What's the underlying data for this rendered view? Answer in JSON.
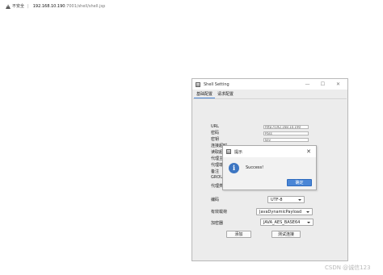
{
  "browser": {
    "security_label": "不安全",
    "url_host": "192.168.10.190",
    "url_rest": ":7001/shell/shell.jsp"
  },
  "window": {
    "title": "Shell Setting",
    "controls": [
      "—",
      "☐",
      "✕"
    ],
    "tabs": [
      {
        "label": "基础配置",
        "active": true
      },
      {
        "label": "请求配置",
        "active": false
      }
    ],
    "fields": {
      "url_label": "URL",
      "url_value": "http://192.168.10.190",
      "password_label": "密码",
      "password_value": "Pass",
      "key_label": "密钥",
      "key_value": "key",
      "conn_timeout_label": "连接超时",
      "read_timeout_label": "读取超时",
      "proxy_host_label": "代理主机",
      "proxy_port_label": "代理端口",
      "remark_label": "备注",
      "group_label": "GROUP",
      "proxy_type_label": "代理类型"
    },
    "encoding": {
      "label": "编码",
      "value": "UTF-8"
    },
    "payload": {
      "label": "有效载荷",
      "value": "JavaDynamicPayload"
    },
    "cryption": {
      "label": "加密器",
      "value": "JAVA_AES_BASE64"
    },
    "buttons": {
      "add": "添加",
      "test": "测试连接"
    }
  },
  "dialog": {
    "title": "提示",
    "message": "Success!",
    "ok_label": "确定"
  },
  "watermark": "CSDN @诚信123"
}
